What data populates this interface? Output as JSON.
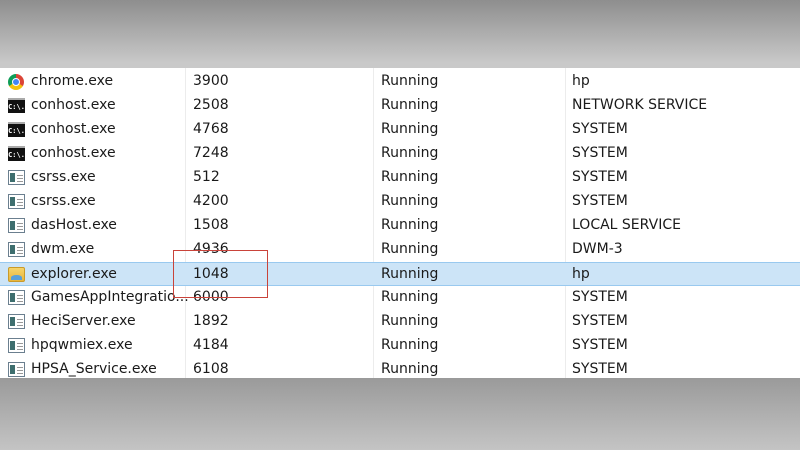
{
  "processes": [
    {
      "name": "chrome.exe",
      "pid": "3900",
      "status": "Running",
      "user": "hp",
      "icon": "chrome-icon"
    },
    {
      "name": "conhost.exe",
      "pid": "2508",
      "status": "Running",
      "user": "NETWORK SERVICE",
      "icon": "console-icon"
    },
    {
      "name": "conhost.exe",
      "pid": "4768",
      "status": "Running",
      "user": "SYSTEM",
      "icon": "console-icon"
    },
    {
      "name": "conhost.exe",
      "pid": "7248",
      "status": "Running",
      "user": "SYSTEM",
      "icon": "console-icon"
    },
    {
      "name": "csrss.exe",
      "pid": "512",
      "status": "Running",
      "user": "SYSTEM",
      "icon": "app-icon"
    },
    {
      "name": "csrss.exe",
      "pid": "4200",
      "status": "Running",
      "user": "SYSTEM",
      "icon": "app-icon"
    },
    {
      "name": "dasHost.exe",
      "pid": "1508",
      "status": "Running",
      "user": "LOCAL SERVICE",
      "icon": "app-icon"
    },
    {
      "name": "dwm.exe",
      "pid": "4936",
      "status": "Running",
      "user": "DWM-3",
      "icon": "app-icon"
    },
    {
      "name": "explorer.exe",
      "pid": "1048",
      "status": "Running",
      "user": "hp",
      "icon": "folder-icon",
      "selected": true
    },
    {
      "name": "GamesAppIntegratio...",
      "pid": "6000",
      "status": "Running",
      "user": "SYSTEM",
      "icon": "app-icon"
    },
    {
      "name": "HeciServer.exe",
      "pid": "1892",
      "status": "Running",
      "user": "SYSTEM",
      "icon": "app-icon"
    },
    {
      "name": "hpqwmiex.exe",
      "pid": "4184",
      "status": "Running",
      "user": "SYSTEM",
      "icon": "app-icon"
    },
    {
      "name": "HPSA_Service.exe",
      "pid": "6108",
      "status": "Running",
      "user": "SYSTEM",
      "icon": "app-icon"
    }
  ],
  "console_icon_text": "C:\\.",
  "colors": {
    "selection": "#cce4f7",
    "highlight_box": "#c9433a"
  }
}
